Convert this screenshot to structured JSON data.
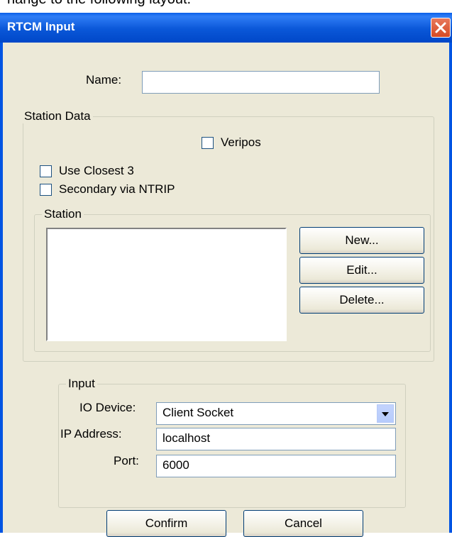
{
  "background": {
    "top_text": "hange to the following layout."
  },
  "window": {
    "title": "RTCM Input"
  },
  "form": {
    "name_label": "Name:",
    "name_value": ""
  },
  "station_data": {
    "legend": "Station Data",
    "veripos_label": "Veripos",
    "veripos_checked": false,
    "use_closest_label": "Use Closest 3",
    "use_closest_checked": false,
    "secondary_label": "Secondary via NTRIP",
    "secondary_checked": false,
    "station": {
      "legend": "Station",
      "items": [],
      "new_label": "New...",
      "edit_label": "Edit...",
      "delete_label": "Delete..."
    }
  },
  "input": {
    "legend": "Input",
    "io_device_label": "IO Device:",
    "io_device_value": "Client Socket",
    "ip_label": "IP Address:",
    "ip_value": "localhost",
    "port_label": "Port:",
    "port_value": "6000"
  },
  "footer": {
    "confirm_label": "Confirm",
    "cancel_label": "Cancel"
  },
  "colors": {
    "titlebar": "#0054e3",
    "dialog_bg": "#ece9d8",
    "close_button": "#d44a24"
  }
}
